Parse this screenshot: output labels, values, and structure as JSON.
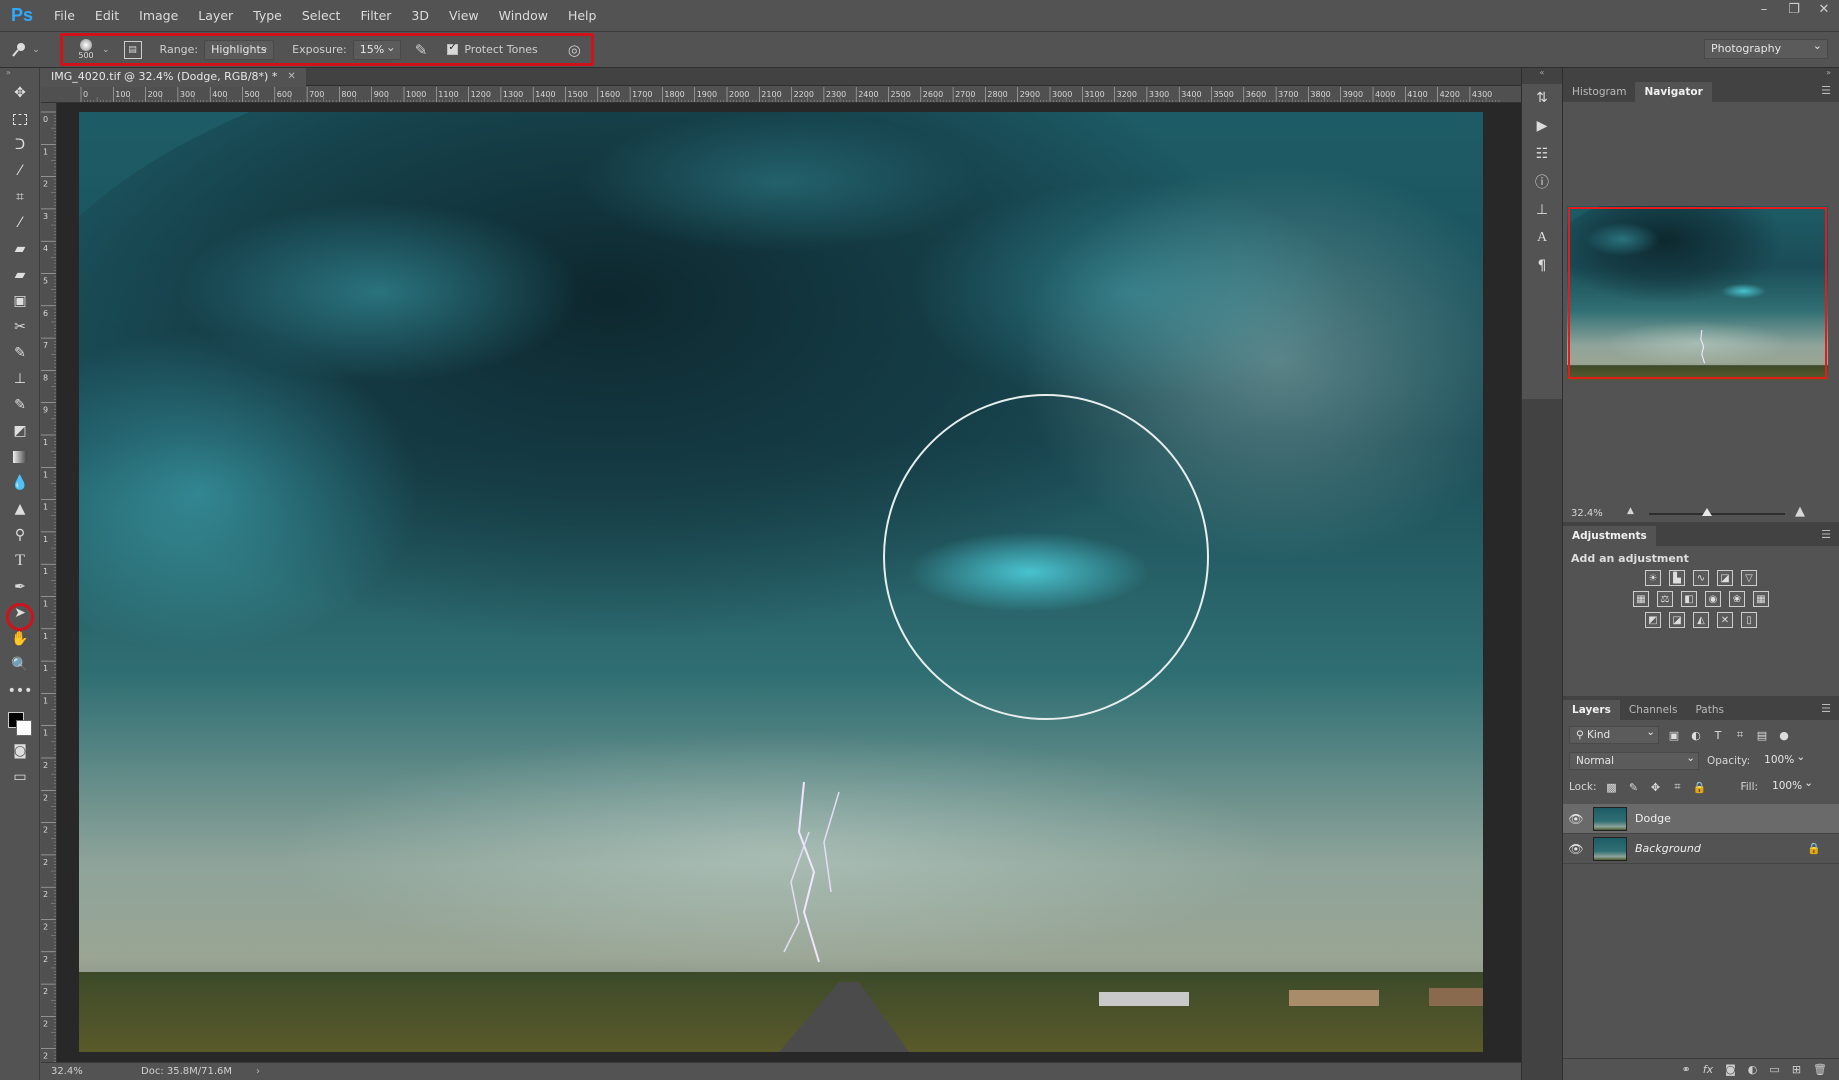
{
  "app": {
    "logo": "Ps"
  },
  "menu": [
    "File",
    "Edit",
    "Image",
    "Layer",
    "Type",
    "Select",
    "Filter",
    "3D",
    "View",
    "Window",
    "Help"
  ],
  "options": {
    "brush_size": "500",
    "range_label": "Range:",
    "range_value": "Highlights",
    "exposure_label": "Exposure:",
    "exposure_value": "15%",
    "protect_tones_label": "Protect Tones",
    "protect_tones_checked": true,
    "workspace": "Photography"
  },
  "document": {
    "tab_title": "IMG_4020.tif @ 32.4% (Dodge, RGB/8*) *",
    "ruler_top": [
      "0",
      "100",
      "200",
      "300",
      "400",
      "500",
      "600",
      "700",
      "800",
      "900",
      "1000",
      "1100",
      "1200",
      "1300",
      "1400",
      "1500",
      "1600",
      "1700",
      "1800",
      "1900",
      "2000",
      "2100",
      "2200",
      "2300",
      "2400",
      "2500",
      "2600",
      "2700",
      "2800",
      "2900",
      "3000",
      "3100",
      "3200",
      "3300",
      "3400",
      "3500",
      "3600",
      "3700",
      "3800",
      "3900",
      "4000",
      "4100",
      "4200",
      "4300"
    ],
    "ruler_left": [
      "0",
      "1",
      "2",
      "3",
      "4",
      "5",
      "6",
      "7",
      "8",
      "9",
      "1",
      "1",
      "1",
      "1",
      "1",
      "1",
      "1",
      "1",
      "1",
      "1",
      "2",
      "2",
      "2",
      "2",
      "2",
      "2",
      "2",
      "2",
      "2",
      "2"
    ]
  },
  "status": {
    "zoom": "32.4%",
    "doc_size": "Doc: 35.8M/71.6M"
  },
  "navigator": {
    "tabs": [
      "Histogram",
      "Navigator"
    ],
    "active_tab": "Navigator",
    "zoom": "32.4%"
  },
  "adjustments": {
    "title": "Adjustments",
    "subtitle": "Add an adjustment"
  },
  "layers": {
    "tabs": [
      "Layers",
      "Channels",
      "Paths"
    ],
    "filter_kind": "Kind",
    "blend_mode": "Normal",
    "opacity_label": "Opacity:",
    "opacity_value": "100%",
    "lock_label": "Lock:",
    "fill_label": "Fill:",
    "fill_value": "100%",
    "items": [
      {
        "name": "Dodge",
        "selected": true,
        "locked": false
      },
      {
        "name": "Background",
        "selected": false,
        "locked": true
      }
    ]
  },
  "colors": {
    "highlight_red": "#d0121b",
    "ps_blue": "#31a8ff",
    "ui_bg": "#535353",
    "panel_dark": "#424242"
  }
}
